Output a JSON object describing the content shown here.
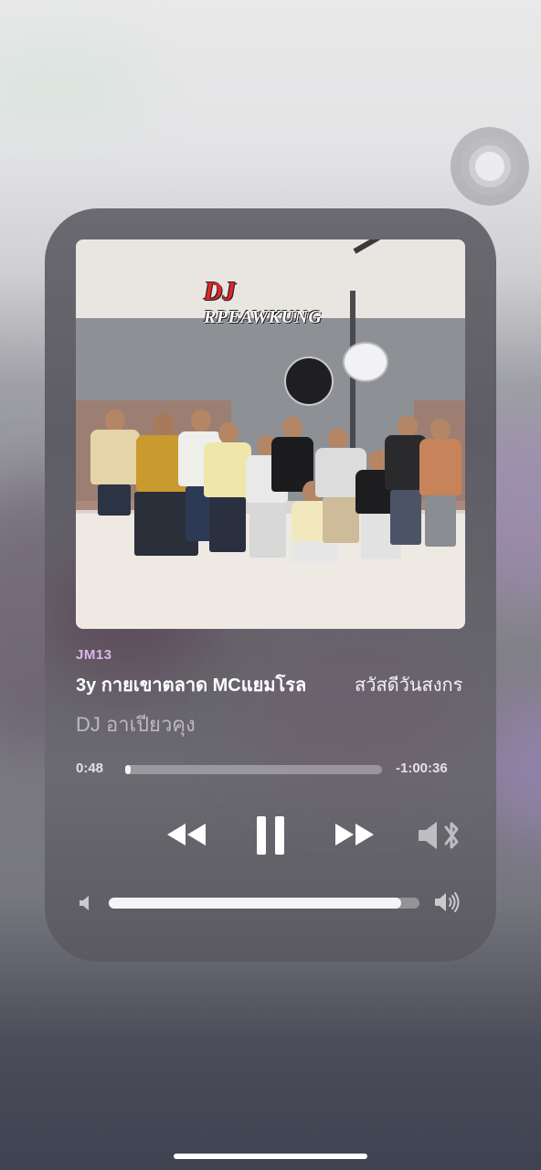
{
  "now_playing": {
    "album_label": "JM13",
    "title_part1": "3y กายเขาตลาด MCแยมโรล",
    "title_part2": "สวัสดีวันสงกร",
    "artist": "DJ อาเปียวคุง",
    "artwork_logo_text": "DJ RPEAWKUNG"
  },
  "progress": {
    "elapsed": "0:48",
    "remaining": "-1:00:36",
    "fraction": 0.01
  },
  "controls": {
    "rewind_icon": "rewind-icon",
    "pause_icon": "pause-icon",
    "forward_icon": "fast-forward-icon",
    "output_icon": "bluetooth-speaker-icon"
  },
  "volume": {
    "level": 0.94,
    "low_icon": "speaker-low-icon",
    "high_icon": "speaker-high-icon"
  },
  "colors": {
    "accent_label": "#d9b8e8",
    "title": "#ffffff",
    "artist": "#c0b6c6"
  }
}
